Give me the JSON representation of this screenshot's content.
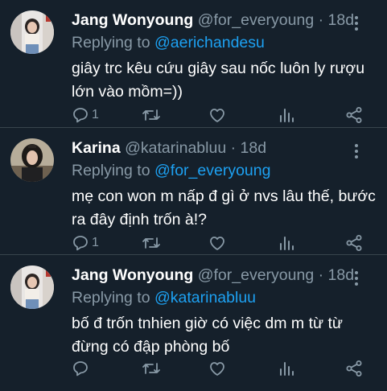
{
  "tweets": [
    {
      "name": "Jang Wonyoung",
      "handle": "@for_everyoung",
      "time": "· 18d",
      "reply_prefix": "Replying to ",
      "reply_to": "@aerichandesu",
      "text": "giây trc kêu cứu giây sau nốc luôn ly rượu lớn vào mồm=))",
      "reply_count": "1",
      "retweet_count": "",
      "like_count": ""
    },
    {
      "name": "Karina",
      "handle": "@katarinabluu",
      "time": "· 18d",
      "reply_prefix": "Replying to ",
      "reply_to": "@for_everyoung",
      "text": "mẹ con won m nấp đ gì ở nvs lâu thế, bước ra đây định trốn à!?",
      "reply_count": "1",
      "retweet_count": "",
      "like_count": ""
    },
    {
      "name": "Jang Wonyoung",
      "handle": "@for_everyoung",
      "time": "· 18d",
      "reply_prefix": "Replying to ",
      "reply_to": "@katarinabluu",
      "text": "bố đ trốn tnhien giờ có việc dm m từ từ đừng có đập phòng bố",
      "reply_count": "",
      "retweet_count": "",
      "like_count": ""
    }
  ],
  "icons": {
    "reply": "reply-icon",
    "retweet": "retweet-icon",
    "like": "heart-icon",
    "analytics": "analytics-icon",
    "share": "share-icon",
    "more": "more-icon"
  },
  "colors": {
    "background": "#15202b",
    "secondary_text": "#8899a6",
    "link": "#1da1f2",
    "divider": "#38444d"
  }
}
